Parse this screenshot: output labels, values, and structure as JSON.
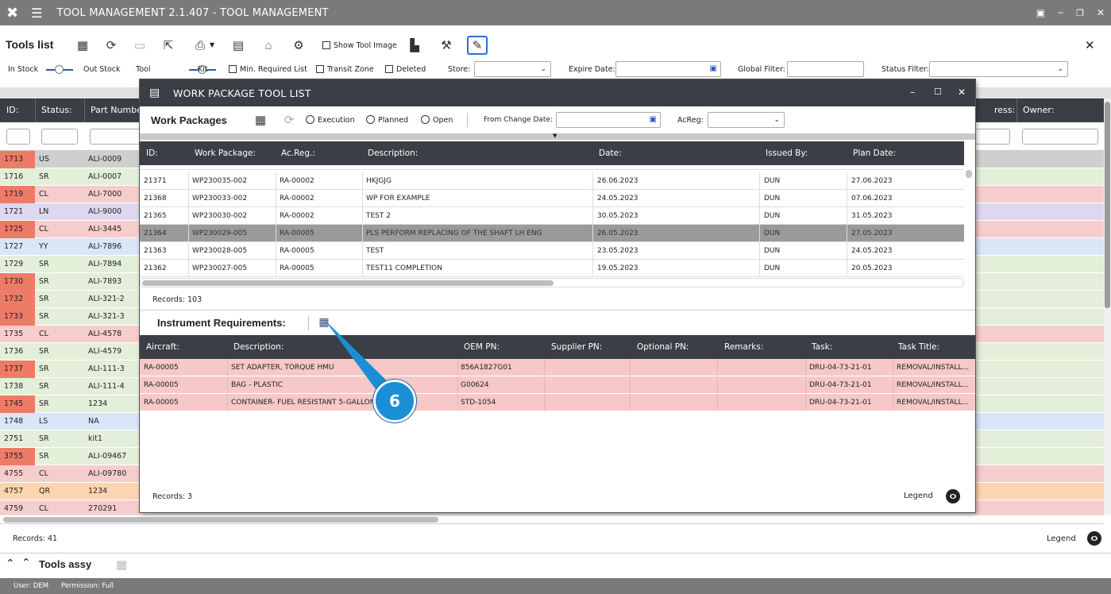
{
  "app": {
    "title": "TOOL MANAGEMENT 2.1.407 - TOOL MANAGEMENT"
  },
  "toolbar": {
    "title": "Tools list",
    "show_tool_image": "Show Tool Image",
    "in_stock": "In Stock",
    "out_stock": "Out Stock",
    "tool": "Tool",
    "kit": "Kit",
    "min_required": "Min. Required List",
    "transit_zone": "Transit Zone",
    "deleted": "Deleted",
    "store_label": "Store:",
    "expire_label": "Expire Date:",
    "global_filter_label": "Global Filter:",
    "status_filter_label": "Status Filter:"
  },
  "grid": {
    "headers": {
      "id": "ID:",
      "status": "Status:",
      "part": "Part Number",
      "progress": "ress:",
      "owner": "Owner:"
    },
    "rows": [
      {
        "id": "1713",
        "status": "US",
        "part": "ALI-0009"
      },
      {
        "id": "1716",
        "status": "SR",
        "part": "ALI-0007"
      },
      {
        "id": "1719",
        "status": "CL",
        "part": "ALI-7000"
      },
      {
        "id": "1721",
        "status": "LN",
        "part": "ALI-9000"
      },
      {
        "id": "1725",
        "status": "CL",
        "part": "ALI-3445"
      },
      {
        "id": "1727",
        "status": "YY",
        "part": "ALI-7896"
      },
      {
        "id": "1729",
        "status": "SR",
        "part": "ALI-7894"
      },
      {
        "id": "1730",
        "status": "SR",
        "part": "ALI-7893"
      },
      {
        "id": "1732",
        "status": "SR",
        "part": "ALI-321-2"
      },
      {
        "id": "1733",
        "status": "SR",
        "part": "ALI-321-3"
      },
      {
        "id": "1735",
        "status": "CL",
        "part": "ALI-4578"
      },
      {
        "id": "1736",
        "status": "SR",
        "part": "ALI-4579"
      },
      {
        "id": "1737",
        "status": "SR",
        "part": "ALI-111-3"
      },
      {
        "id": "1738",
        "status": "SR",
        "part": "ALI-111-4"
      },
      {
        "id": "1745",
        "status": "SR",
        "part": "1234"
      },
      {
        "id": "1748",
        "status": "LS",
        "part": "NA"
      },
      {
        "id": "2751",
        "status": "SR",
        "part": "kit1"
      },
      {
        "id": "3755",
        "status": "SR",
        "part": "ALI-09467"
      },
      {
        "id": "4755",
        "status": "CL",
        "part": "ALI-09780"
      },
      {
        "id": "4757",
        "status": "QR",
        "part": "1234"
      },
      {
        "id": "4759",
        "status": "CL",
        "part": "270291"
      }
    ],
    "records": "Records: 41",
    "legend": "Legend"
  },
  "assy": {
    "title": "Tools assy"
  },
  "user": {
    "user": "User: DEM",
    "permission": "Permission: Full"
  },
  "dialog": {
    "title": "WORK PACKAGE TOOL LIST",
    "wp_title": "Work Packages",
    "execution": "Execution",
    "planned": "Planned",
    "open": "Open",
    "from_change_date": "From Change Date:",
    "acreg": "AcReg:",
    "wp_headers": {
      "id": "ID:",
      "wp": "Work Package:",
      "acreg": "Ac.Reg.:",
      "desc": "Description:",
      "date": "Date:",
      "issued": "Issued By:",
      "plan": "Plan Date:"
    },
    "wp_rows": [
      {
        "id": "21371",
        "wp": "WP230035-002",
        "acreg": "RA-00002",
        "desc": "HKJGJG",
        "date": "26.06.2023",
        "issued": "DUN",
        "plan": "27.06.2023"
      },
      {
        "id": "21368",
        "wp": "WP230033-002",
        "acreg": "RA-00002",
        "desc": "WP FOR EXAMPLE",
        "date": "24.05.2023",
        "issued": "DUN",
        "plan": "07.06.2023"
      },
      {
        "id": "21365",
        "wp": "WP230030-002",
        "acreg": "RA-00002",
        "desc": "TEST 2",
        "date": "30.05.2023",
        "issued": "DUN",
        "plan": "31.05.2023"
      },
      {
        "id": "21364",
        "wp": "WP230029-005",
        "acreg": "RA-00005",
        "desc": "PLS PERFORM REPLACING OF THE SHAFT LH ENG",
        "date": "26.05.2023",
        "issued": "DUN",
        "plan": "27.05.2023"
      },
      {
        "id": "21363",
        "wp": "WP230028-005",
        "acreg": "RA-00005",
        "desc": "TEST",
        "date": "23.05.2023",
        "issued": "DUN",
        "plan": "24.05.2023"
      },
      {
        "id": "21362",
        "wp": "WP230027-005",
        "acreg": "RA-00005",
        "desc": "TEST11 COMPLETION",
        "date": "19.05.2023",
        "issued": "DUN",
        "plan": "20.05.2023"
      }
    ],
    "wp_records": "Records: 103",
    "ir_title": "Instrument Requirements:",
    "ir_headers": {
      "aircraft": "Aircraft:",
      "desc": "Description:",
      "oem": "OEM PN:",
      "supplier": "Supplier PN:",
      "optional": "Optional PN:",
      "remarks": "Remarks:",
      "task": "Task:",
      "tasktitle": "Task Title:"
    },
    "ir_rows": [
      {
        "aircraft": "RA-00005",
        "desc": "SET ADAPTER, TORQUE HMU",
        "oem": "856A1827G01",
        "task": "DRU-04-73-21-01",
        "tasktitle": "REMOVAL/INSTALL..."
      },
      {
        "aircraft": "RA-00005",
        "desc": "BAG - PLASTIC",
        "oem": "G00624",
        "task": "DRU-04-73-21-01",
        "tasktitle": "REMOVAL/INSTALL..."
      },
      {
        "aircraft": "RA-00005",
        "desc": "CONTAINER- FUEL RESISTANT 5-GALLON",
        "oem": "STD-1054",
        "task": "DRU-04-73-21-01",
        "tasktitle": "REMOVAL/INSTALL..."
      }
    ],
    "ir_records": "Records: 3",
    "legend": "Legend"
  },
  "callout": {
    "number": "6"
  }
}
